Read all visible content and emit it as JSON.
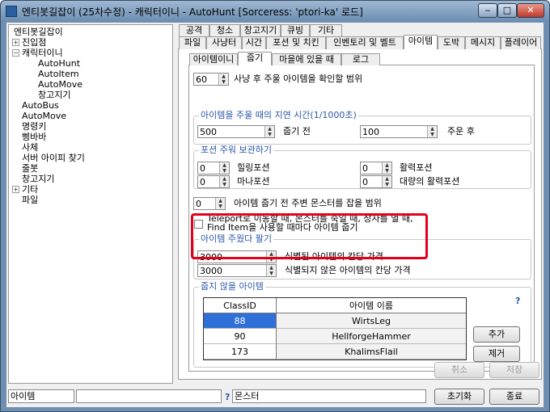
{
  "window": {
    "title": "엔티봇길잡이 (25차수정) - 캐릭터이니 - AutoHunt [Sorceress: 'ptori-ka' 로드]"
  },
  "tree": {
    "items": [
      {
        "label": "엔티봇길잡이"
      },
      {
        "label": "진입점",
        "expander": "+"
      },
      {
        "label": "캐릭터이니",
        "expander": "−"
      },
      {
        "label": "AutoHunt"
      },
      {
        "label": "AutoItem"
      },
      {
        "label": "AutoMove"
      },
      {
        "label": "창고지기"
      },
      {
        "label": "AutoBus"
      },
      {
        "label": "AutoMove"
      },
      {
        "label": "명령키"
      },
      {
        "label": "삥바바"
      },
      {
        "label": "사체"
      },
      {
        "label": "서버 아이피 찾기"
      },
      {
        "label": "줄봇"
      },
      {
        "label": "창고지기"
      },
      {
        "label": "기타",
        "expander": "+"
      },
      {
        "label": "파일"
      }
    ]
  },
  "tabs_row1": [
    "공격",
    "청소",
    "창고지기",
    "큐빙",
    "기타"
  ],
  "tabs_row2": [
    "파일",
    "사냥터",
    "시간",
    "포션 및 치킨",
    "인벤토리 및 벨트",
    "아이템",
    "도박",
    "메시지",
    "플레이어"
  ],
  "active_tab": "아이템",
  "subtabs": [
    "아이템이니",
    "줍기",
    "마을에 있을 때",
    "로그"
  ],
  "active_subtab": "줍기",
  "pickup_range": {
    "value": "60",
    "label": "사냥 후 주울 아이템을 확인할 범위"
  },
  "delay_group": {
    "title": "아이템을 주울 때의 지연 시간(1/1000초)",
    "before_value": "500",
    "before_label": "줍기 전",
    "after_value": "100",
    "after_label": "주운 후"
  },
  "potion_group": {
    "title": "포션 주워 보관하기",
    "healing_value": "0",
    "healing_label": "힐링포션",
    "mana_value": "0",
    "mana_label": "마나포션",
    "rejuv_value": "0",
    "rejuv_label": "활력포션",
    "full_rejuv_value": "0",
    "full_rejuv_label": "대량의 활력포션"
  },
  "monster_range": {
    "value": "0",
    "label": "아이템 줍기 전 주변 몬스터를 잡을 범위"
  },
  "teleport_option": {
    "line1": "Teleport로 이동할 때, 몬스터를 죽일 때, 상자를 열 때,",
    "line2": "Find Item을 사용할 때마다 아이템 줍기"
  },
  "sell_group": {
    "title": "아이템 주웠다 팔기",
    "identified_value": "3000",
    "identified_label": "식별된 아이템의 칸당 가격",
    "unidentified_value": "3000",
    "unidentified_label": "식별되지 않은 아이템의 칸당 가격"
  },
  "ignore_group": {
    "title": "줍지 않을 아이템",
    "help": "?",
    "columns": [
      "ClassID",
      "아이템 이름"
    ],
    "rows": [
      {
        "id": "88",
        "name": "WirtsLeg"
      },
      {
        "id": "90",
        "name": "HellforgeHammer"
      },
      {
        "id": "173",
        "name": "KhalimsFlail"
      }
    ],
    "add_label": "추가",
    "remove_label": "제거"
  },
  "footer": {
    "cancel_label": "취소",
    "save_label": "저장"
  },
  "statusbar": {
    "left_value": "아이템",
    "help": "?",
    "mid_value": "몬스터",
    "reset_label": "초기화",
    "exit_label": "종료"
  },
  "colors": {
    "highlight": "#e3001b",
    "selected_row": "#2e6fd8",
    "group_title": "#2b58a8"
  }
}
